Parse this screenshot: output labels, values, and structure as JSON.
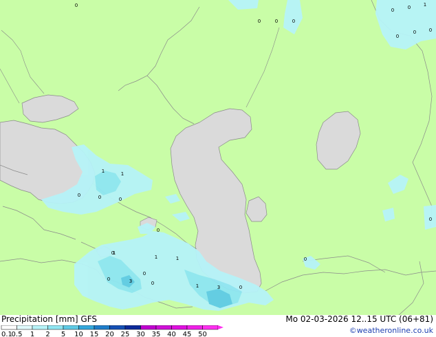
{
  "title_left": "Precipitation [mm]",
  "model": "GFS",
  "timestamp": "Mo 02-03-2026 12..15 UTC (06+81)",
  "credit": "©weatheronline.co.uk",
  "colors": {
    "land": "#c9fda7",
    "water": "#dadada",
    "border": "#8a8a8a",
    "precip_light": "#b6f3f8",
    "precip_mid": "#8fe6f2",
    "precip_heavy": "#5fcbe6"
  },
  "scale": {
    "labels": [
      "0.1",
      "0.5",
      "1",
      "2",
      "5",
      "10",
      "15",
      "20",
      "25",
      "30",
      "35",
      "40",
      "45",
      "50"
    ],
    "colors": [
      "#ffffff",
      "#e0fafc",
      "#b6f3f8",
      "#8fe6f2",
      "#5fcbe6",
      "#34a8dc",
      "#1f7ecb",
      "#1550b5",
      "#0d2a9a",
      "#c000d0",
      "#d010d8",
      "#e010e0",
      "#f020e8",
      "#ff30f0"
    ]
  },
  "map_labels": [
    "0",
    "0",
    "0",
    "0",
    "0",
    "0",
    "0",
    "1",
    "0",
    "0",
    "1",
    "1",
    "1",
    "0",
    "0",
    "0",
    "0",
    "1",
    "0",
    "1",
    "0",
    "0",
    "0",
    "3",
    "0",
    "1",
    "3",
    "0",
    "0"
  ]
}
